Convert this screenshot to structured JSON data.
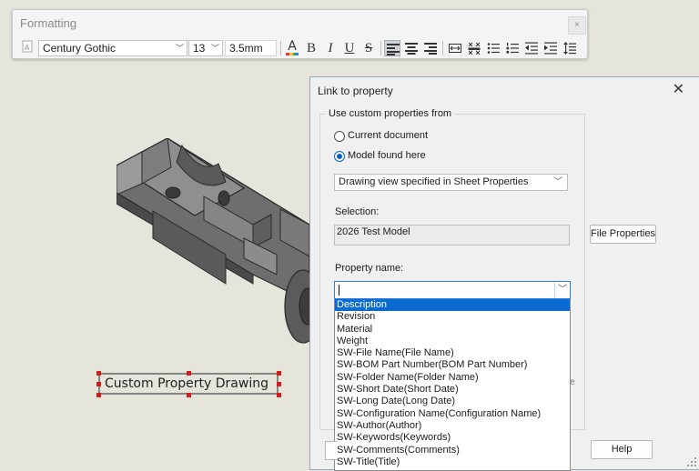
{
  "formatting": {
    "title": "Formatting",
    "close_glyph": "×",
    "font_name": "Century Gothic",
    "font_size": "13",
    "font_height": "3.5mm",
    "bold_glyph": "B",
    "italic_glyph": "I",
    "underline_glyph": "U",
    "strike_glyph": "S"
  },
  "note": {
    "text": "Custom Property Drawing"
  },
  "dialog": {
    "title": "Link to property",
    "close_glyph": "✕",
    "group_label": "Use custom properties from",
    "radio_current": "Current document",
    "radio_model": "Model found here",
    "source_select": "Drawing view specified in Sheet Properties",
    "selection_label": "Selection:",
    "selection_value": "2026 Test Model",
    "file_properties_button": "File Properties",
    "property_name_label": "Property name:",
    "property_name_value": "",
    "hint_glyph": "e",
    "help_button": "Help",
    "property_options": [
      "Description",
      "Revision",
      "Material",
      "Weight",
      "SW-File Name(File Name)",
      "SW-BOM Part Number(BOM Part Number)",
      "SW-Folder Name(Folder Name)",
      "SW-Short Date(Short Date)",
      "SW-Long Date(Long Date)",
      "SW-Configuration Name(Configuration Name)",
      "SW-Author(Author)",
      "SW-Keywords(Keywords)",
      "SW-Comments(Comments)",
      "SW-Title(Title)"
    ],
    "selected_option": "Description"
  },
  "colors": {
    "accent": "#0b6ad0",
    "selection_handle": "#d21c1c"
  }
}
